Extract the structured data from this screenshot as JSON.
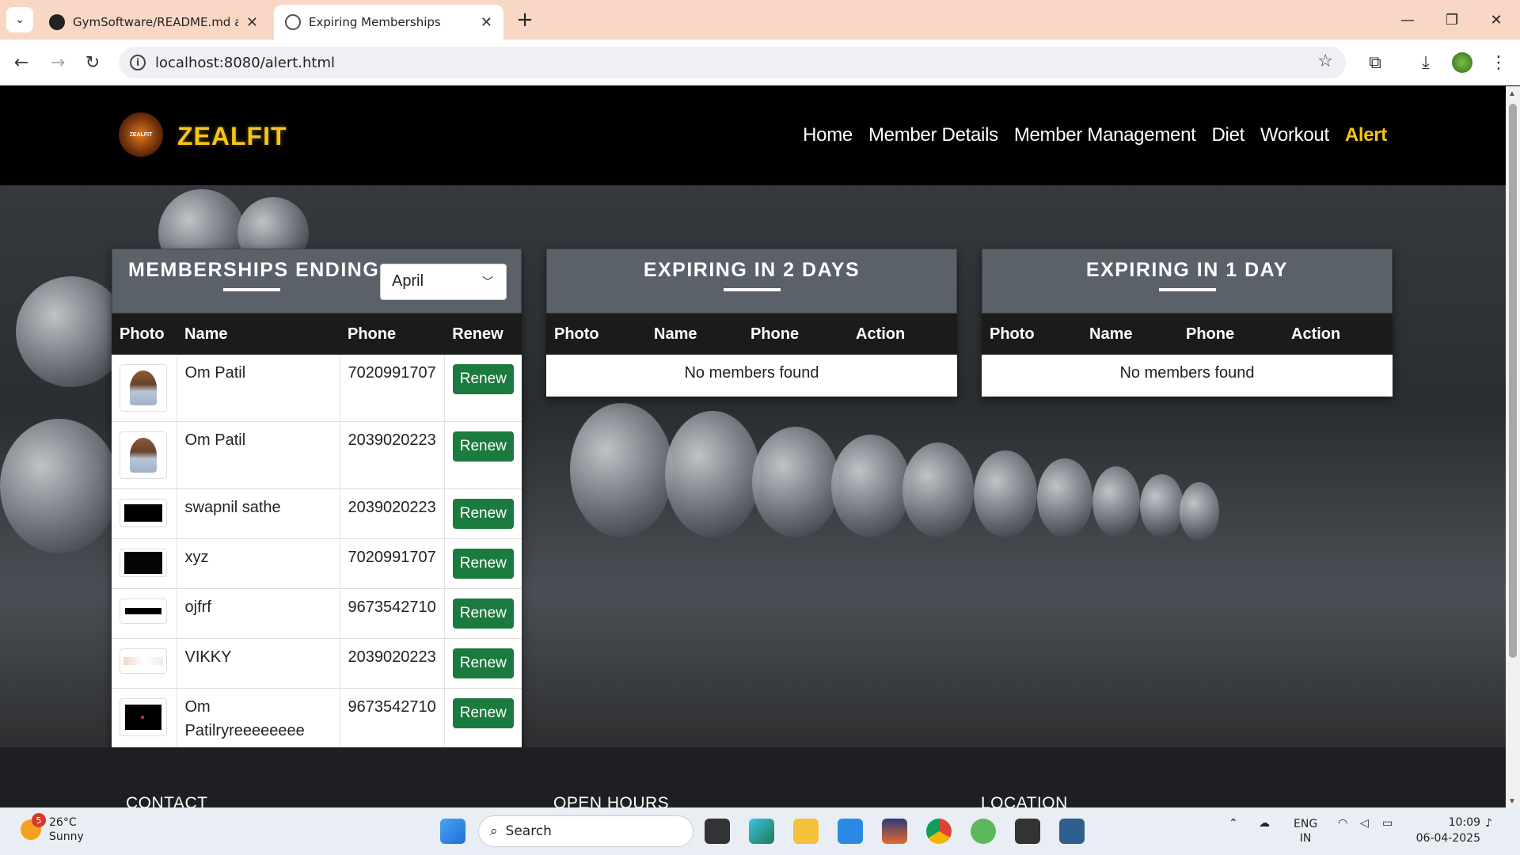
{
  "browser": {
    "tabs": [
      {
        "title": "GymSoftware/README.md at m",
        "icon": "github-icon"
      },
      {
        "title": "Expiring Memberships",
        "icon": "globe-icon"
      }
    ],
    "url": "localhost:8080/alert.html"
  },
  "site": {
    "brand": "ZEALFIT",
    "logo_text": "ZEALFIT",
    "nav": [
      "Home",
      "Member Details",
      "Member Management",
      "Diet",
      "Workout",
      "Alert"
    ],
    "active_nav": "Alert",
    "accent": "#f5c518"
  },
  "memberships_card": {
    "title": "MEMBERSHIPS ENDING",
    "month": "April",
    "headers": [
      "Photo",
      "Name",
      "Phone",
      "Renew"
    ],
    "rows": [
      {
        "name": "Om Patil",
        "phone": "7020991707",
        "action": "Renew"
      },
      {
        "name": "Om Patil",
        "phone": "2039020223",
        "action": "Renew"
      },
      {
        "name": "swapnil sathe",
        "phone": "2039020223",
        "action": "Renew"
      },
      {
        "name": "xyz",
        "phone": "7020991707",
        "action": "Renew"
      },
      {
        "name": "ojfrf",
        "phone": "9673542710",
        "action": "Renew"
      },
      {
        "name": "VIKKY",
        "phone": "2039020223",
        "action": "Renew"
      },
      {
        "name": "Om Patilryreeeeeeee",
        "phone": "9673542710",
        "action": "Renew"
      }
    ]
  },
  "expiring_2": {
    "title": "EXPIRING IN 2 DAYS",
    "headers": [
      "Photo",
      "Name",
      "Phone",
      "Action"
    ],
    "empty": "No members found"
  },
  "expiring_1": {
    "title": "EXPIRING IN 1 DAY",
    "headers": [
      "Photo",
      "Name",
      "Phone",
      "Action"
    ],
    "empty": "No members found"
  },
  "footer": {
    "contact": "CONTACT",
    "hours": "OPEN HOURS",
    "location": "LOCATION"
  },
  "taskbar": {
    "temp": "26°C",
    "condition": "Sunny",
    "weather_badge": "5",
    "search": "Search",
    "lang1": "ENG",
    "lang2": "IN",
    "time": "10:09",
    "date": "06-04-2025"
  }
}
